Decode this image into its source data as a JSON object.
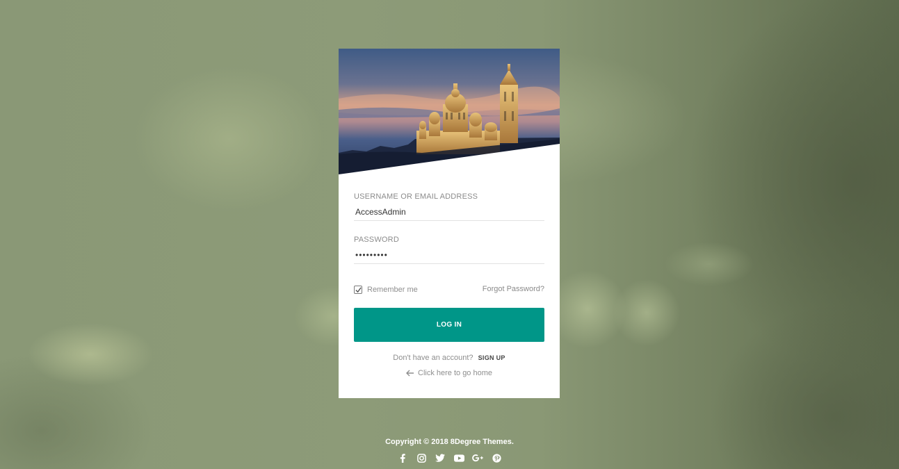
{
  "login": {
    "username_label": "USERNAME OR EMAIL ADDRESS",
    "username_value": "AccessAdmin",
    "password_label": "PASSWORD",
    "password_value": "•••••••••",
    "remember_label": "Remember me",
    "remember_checked": true,
    "forgot_label": "Forgot Password?",
    "login_button": "LOG IN",
    "no_account_text": "Don't have an account?",
    "signup_label": "SIGN UP",
    "home_link": "Click here to go home"
  },
  "footer": {
    "copyright": "Copyright © 2018 8Degree Themes.",
    "social_icons": [
      "facebook-icon",
      "instagram-icon",
      "twitter-icon",
      "youtube-icon",
      "google-plus-icon",
      "pinterest-icon"
    ]
  },
  "colors": {
    "accent": "#009688",
    "card_bg": "#ffffff"
  }
}
